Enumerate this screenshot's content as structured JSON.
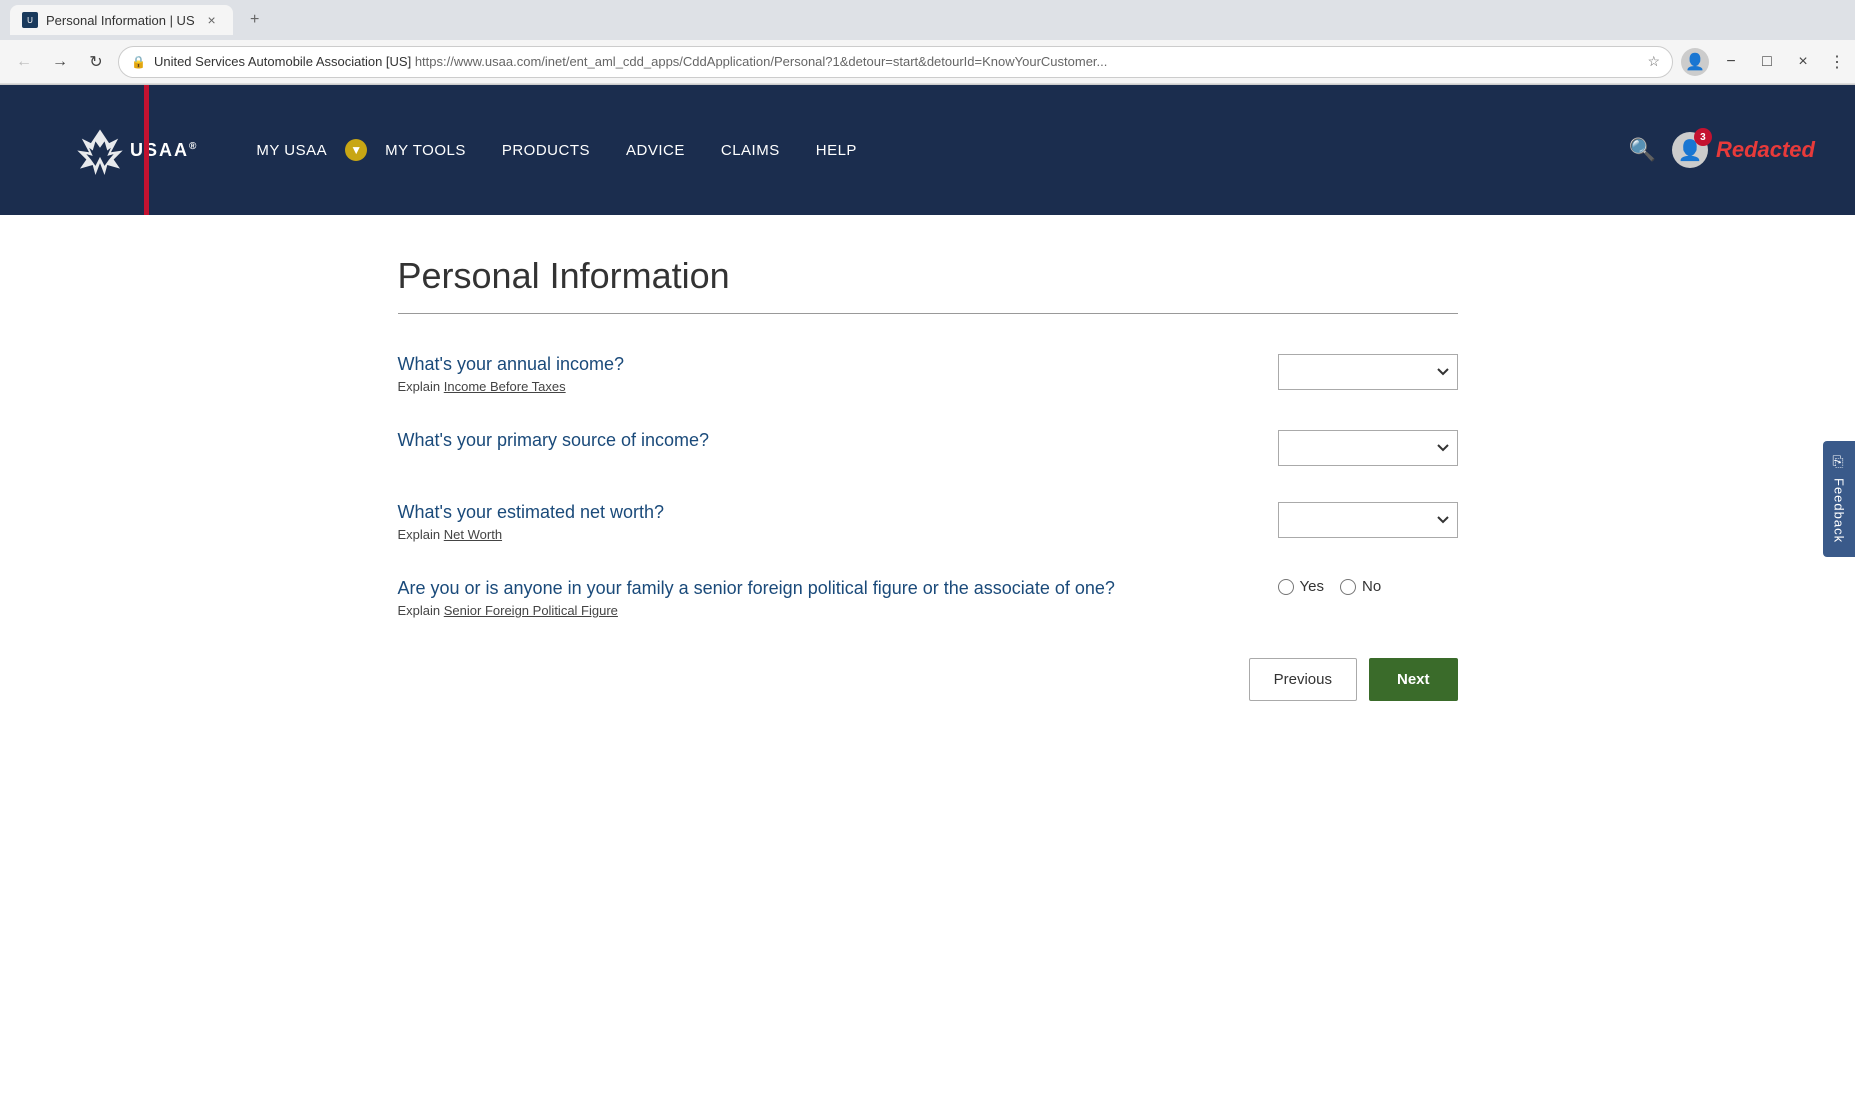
{
  "browser": {
    "tab_title": "Personal Information | US",
    "favicon_text": "U",
    "address_site_name": "United Services Automobile Association [US]",
    "address_url": "https://www.usaa.com/inet/ent_aml_cdd_apps/CddApplication/Personal?1&detour=start&detourId=KnowYourCustomer...",
    "close_label": "×",
    "new_tab_label": "+"
  },
  "nav": {
    "logo_text": "USAA",
    "logo_reg": "®",
    "items": [
      {
        "label": "MY USAA",
        "id": "my-usaa"
      },
      {
        "label": "MY TOOLS",
        "id": "my-tools"
      },
      {
        "label": "PRODUCTS",
        "id": "products"
      },
      {
        "label": "ADVICE",
        "id": "advice"
      },
      {
        "label": "CLAIMS",
        "id": "claims"
      },
      {
        "label": "HELP",
        "id": "help"
      }
    ],
    "notification_count": "3",
    "redacted_label": "Redacted"
  },
  "page": {
    "title": "Personal Information",
    "questions": [
      {
        "id": "annual-income",
        "question": "What's your annual income?",
        "explain_prefix": "Explain",
        "explain_link": "Income Before Taxes",
        "type": "select",
        "options": []
      },
      {
        "id": "primary-income-source",
        "question": "What's your primary source of income?",
        "explain_prefix": "",
        "explain_link": "",
        "type": "select",
        "options": []
      },
      {
        "id": "net-worth",
        "question": "What's your estimated net worth?",
        "explain_prefix": "Explain",
        "explain_link": "Net Worth",
        "type": "select",
        "options": []
      },
      {
        "id": "political-figure",
        "question": "Are you or is anyone in your family a senior foreign political figure or the associate of one?",
        "explain_prefix": "Explain",
        "explain_link": "Senior Foreign Political Figure",
        "type": "radio",
        "options": [
          {
            "label": "Yes",
            "value": "yes"
          },
          {
            "label": "No",
            "value": "no"
          }
        ]
      }
    ],
    "buttons": {
      "previous": "Previous",
      "next": "Next"
    },
    "feedback": "Feedback"
  }
}
